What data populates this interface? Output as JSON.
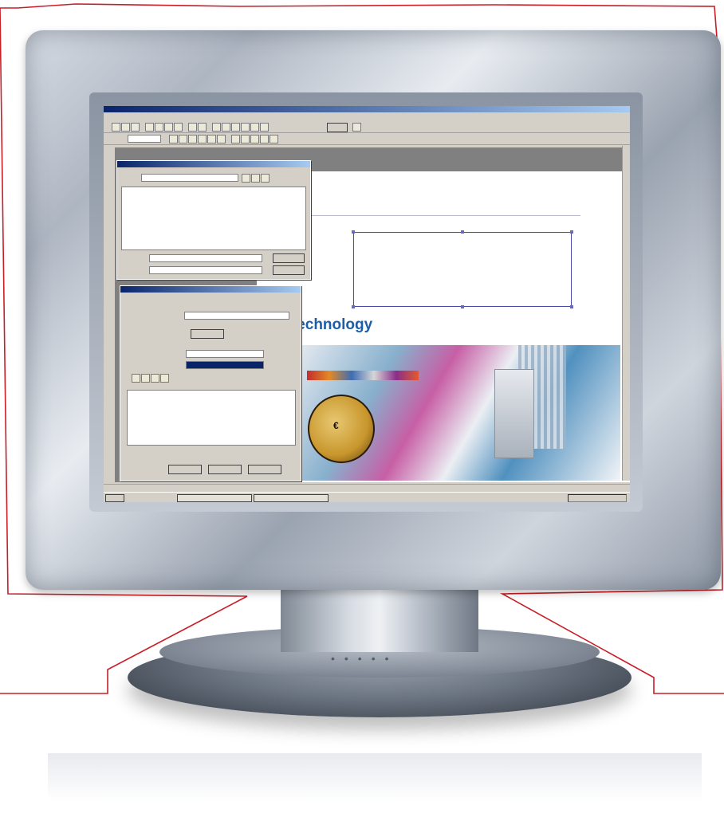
{
  "screen": {
    "document": {
      "headline_fragment": "Technology"
    }
  }
}
